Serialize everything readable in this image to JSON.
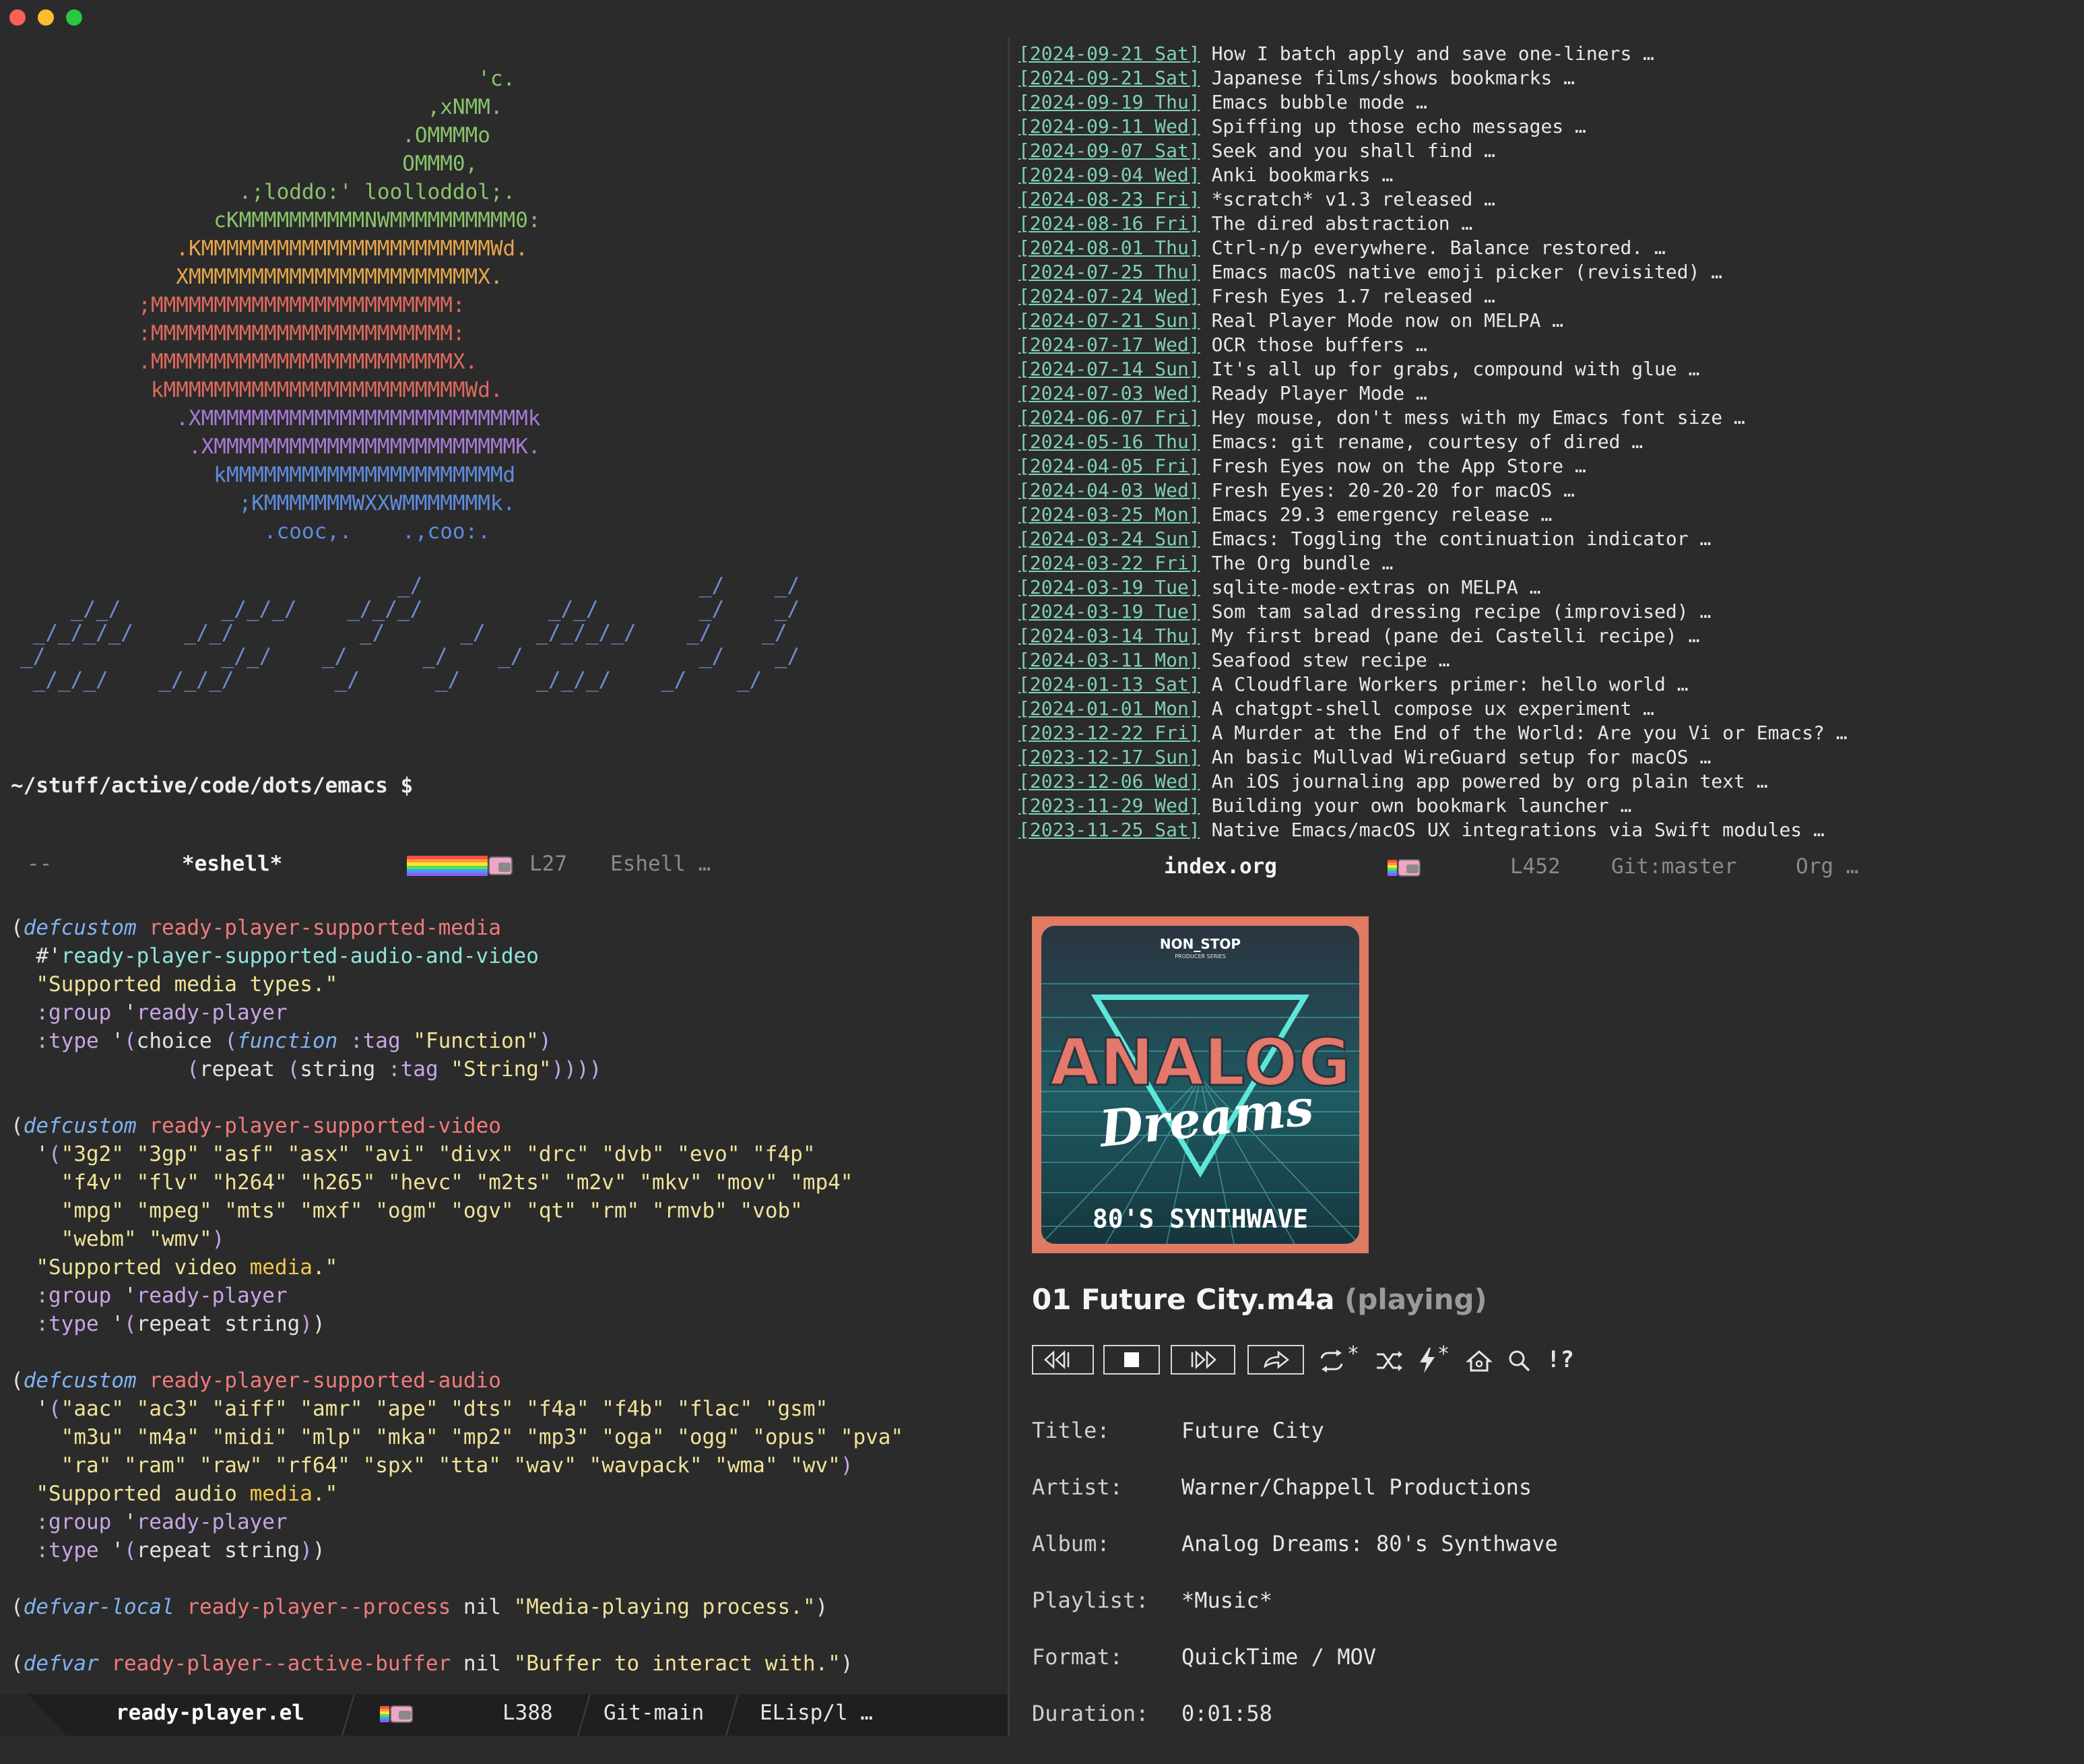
{
  "left_top": {
    "logo_lines": [
      "                                      'c.",
      "                                  ,xNMM.",
      "                                .OMMMMo",
      "                                OMMM0,",
      "                   .;loddo:' loolloddol;.",
      "                 cKMMMMMMMMMMNWMMMMMMMMMM0:",
      "              .KMMMMMMMMMMMMMMMMMMMMMMMWd.",
      "              XMMMMMMMMMMMMMMMMMMMMMMMX.",
      "           ;MMMMMMMMMMMMMMMMMMMMMMMM:",
      "           :MMMMMMMMMMMMMMMMMMMMMMMM:",
      "           .MMMMMMMMMMMMMMMMMMMMMMMMX.",
      "            kMMMMMMMMMMMMMMMMMMMMMMMMWd.",
      "              .XMMMMMMMMMMMMMMMMMMMMMMMMMMk",
      "               .XMMMMMMMMMMMMMMMMMMMMMMMMK.",
      "                 kMMMMMMMMMMMMMMMMMMMMMMd",
      "                   ;KMMMMMMMWXXWMMMMMMMk.",
      "                     .cooc,.    .,coo:."
    ],
    "logo_colors": [
      "#89c46b",
      "#89c46b",
      "#89c46b",
      "#89c46b",
      "#89c46b",
      "#89c46b",
      "#e6a64a",
      "#e6a64a",
      "#e0695d",
      "#e0695d",
      "#e0695d",
      "#e0695d",
      "#a97ad6",
      "#a97ad6",
      "#5f8de0",
      "#5f8de0",
      "#5f8de0"
    ],
    "slant_lines": [
      "                              _/                      _/    _/",
      "    _/_/        _/_/_/    _/_/_/          _/_/        _/    _/",
      " _/_/_/_/    _/_/          _/      _/    _/_/_/_/    _/    _/",
      "_/              _/_/    _/      _/    _/              _/    _/",
      " _/_/_/    _/_/_/        _/      _/      _/_/_/    _/    _/"
    ],
    "prompt": "~/stuff/active/code/dots/emacs $"
  },
  "left_top_modeline": {
    "dashes": "--",
    "buffer": "*eshell*",
    "line": "L27",
    "mode": "Eshell …"
  },
  "org_entries": [
    {
      "date": "[2024-09-21 Sat]",
      "title": "How I batch apply and save one-liners …"
    },
    {
      "date": "[2024-09-21 Sat]",
      "title": "Japanese films/shows bookmarks …"
    },
    {
      "date": "[2024-09-19 Thu]",
      "title": "Emacs bubble mode …"
    },
    {
      "date": "[2024-09-11 Wed]",
      "title": "Spiffing up those echo messages …"
    },
    {
      "date": "[2024-09-07 Sat]",
      "title": "Seek and you shall find …"
    },
    {
      "date": "[2024-09-04 Wed]",
      "title": "Anki bookmarks …"
    },
    {
      "date": "[2024-08-23 Fri]",
      "title": "*scratch* v1.3 released …"
    },
    {
      "date": "[2024-08-16 Fri]",
      "title": "The dired abstraction …"
    },
    {
      "date": "[2024-08-01 Thu]",
      "title": "Ctrl-n/p everywhere. Balance restored. …"
    },
    {
      "date": "[2024-07-25 Thu]",
      "title": "Emacs macOS native emoji picker (revisited) …"
    },
    {
      "date": "[2024-07-24 Wed]",
      "title": "Fresh Eyes 1.7 released …"
    },
    {
      "date": "[2024-07-21 Sun]",
      "title": "Real Player Mode now on MELPA …"
    },
    {
      "date": "[2024-07-17 Wed]",
      "title": "OCR those buffers …"
    },
    {
      "date": "[2024-07-14 Sun]",
      "title": "It's all up for grabs, compound with glue …"
    },
    {
      "date": "[2024-07-03 Wed]",
      "title": "Ready Player Mode …"
    },
    {
      "date": "[2024-06-07 Fri]",
      "title": "Hey mouse, don't mess with my Emacs font size …"
    },
    {
      "date": "[2024-05-16 Thu]",
      "title": "Emacs: git rename, courtesy of dired …"
    },
    {
      "date": "[2024-04-05 Fri]",
      "title": "Fresh Eyes now on the App Store …"
    },
    {
      "date": "[2024-04-03 Wed]",
      "title": "Fresh Eyes: 20-20-20 for macOS …"
    },
    {
      "date": "[2024-03-25 Mon]",
      "title": "Emacs 29.3 emergency release …"
    },
    {
      "date": "[2024-03-24 Sun]",
      "title": "Emacs: Toggling the continuation indicator …"
    },
    {
      "date": "[2024-03-22 Fri]",
      "title": "The Org bundle …"
    },
    {
      "date": "[2024-03-19 Tue]",
      "title": "sqlite-mode-extras on MELPA …"
    },
    {
      "date": "[2024-03-19 Tue]",
      "title": "Som tam salad dressing recipe (improvised) …"
    },
    {
      "date": "[2024-03-14 Thu]",
      "title": "My first bread (pane dei Castelli recipe) …"
    },
    {
      "date": "[2024-03-11 Mon]",
      "title": "Seafood stew recipe …"
    },
    {
      "date": "[2024-01-13 Sat]",
      "title": "A Cloudflare Workers primer: hello world …"
    },
    {
      "date": "[2024-01-01 Mon]",
      "title": "A chatgpt-shell compose ux experiment …"
    },
    {
      "date": "[2023-12-22 Fri]",
      "title": "A Murder at the End of the World: Are you Vi or Emacs? …"
    },
    {
      "date": "[2023-12-17 Sun]",
      "title": "An basic Mullvad WireGuard setup for macOS …"
    },
    {
      "date": "[2023-12-06 Wed]",
      "title": "An iOS journaling app powered by org plain text …"
    },
    {
      "date": "[2023-11-29 Wed]",
      "title": "Building your own bookmark launcher …"
    },
    {
      "date": "[2023-11-25 Sat]",
      "title": "Native Emacs/macOS UX integrations via Swift modules …"
    }
  ],
  "right_top_modeline": {
    "buffer": "index.org",
    "line": "L452",
    "vc": "Git:master",
    "mode": "Org …"
  },
  "code": {
    "b1": {
      "kw": "defcustom",
      "name": "ready-player-supported-media",
      "val": "ready-player-supported-audio-and-video",
      "doc": "\"Supported media types.\"",
      "group": "ready-player",
      "tag1": "\"Function\"",
      "tag2": "\"String\""
    },
    "b2": {
      "kw": "defcustom",
      "name": "ready-player-supported-video",
      "l1": "\"3g2\" \"3gp\" \"asf\" \"asx\" \"avi\" \"divx\" \"drc\" \"dvb\" \"evo\" \"f4p\"",
      "l2": "\"f4v\" \"flv\" \"h264\" \"h265\" \"hevc\" \"m2ts\" \"m2v\" \"mkv\" \"mov\" \"mp4\"",
      "l3": "\"mpg\" \"mpeg\" \"mts\" \"mxf\" \"ogm\" \"ogv\" \"qt\" \"rm\" \"rmvb\" \"vob\"",
      "l4": "\"webm\" \"wmv\"",
      "doc_a": "\"Supported video ",
      "doc_b": "media",
      "doc_c": ".\"",
      "group": "ready-player"
    },
    "b3": {
      "kw": "defcustom",
      "name": "ready-player-supported-audio",
      "l1": "\"aac\" \"ac3\" \"aiff\" \"amr\" \"ape\" \"dts\" \"f4a\" \"f4b\" \"flac\" \"gsm\"",
      "l2": "\"m3u\" \"m4a\" \"midi\" \"mlp\" \"mka\" \"mp2\" \"mp3\" \"oga\" \"ogg\" \"opus\" \"pva\"",
      "l3": "\"ra\" \"ram\" \"raw\" \"rf64\" \"spx\" \"tta\" \"wav\" \"wavpack\" \"wma\" \"wv\"",
      "doc_a": "\"Supported audio ",
      "doc_b": "media",
      "doc_c": ".\"",
      "group": "ready-player"
    },
    "b4": {
      "kw": "defvar-local",
      "name": "ready-player--process",
      "doc": "\"Media-playing process.\""
    },
    "b5": {
      "kw": "defvar",
      "name": "ready-player--active-buffer",
      "doc": "\"Buffer to interact with.\""
    }
  },
  "bottom_modeline": {
    "buffer": "ready-player.el",
    "line": "L388",
    "vc": "Git-main",
    "mode": "ELisp/l …"
  },
  "album_art": {
    "badge": "NON_STOP",
    "badge_sub": "PRODUCER SERIES",
    "title": "ANALOG",
    "script": "Dreams",
    "subtitle": "80'S SYNTHWAVE"
  },
  "player": {
    "track": "01 Future City.m4a",
    "state": "(playing)",
    "meta": [
      {
        "key": "Title:",
        "value": "Future City"
      },
      {
        "key": "Artist:",
        "value": "Warner/Chappell Productions"
      },
      {
        "key": "Album:",
        "value": "Analog Dreams: 80's Synthwave"
      },
      {
        "key": "Playlist:",
        "value": "*Music*"
      },
      {
        "key": "Format:",
        "value": "QuickTime / MOV"
      },
      {
        "key": "Duration:",
        "value": "0:01:58"
      }
    ],
    "repeat_suffix": "*",
    "autoplay_suffix": "*",
    "help_label": "!?"
  },
  "colors": {
    "bg": "#2b2b2b",
    "accent_date": "#7fcfb9",
    "keyword": "#7fb3f0",
    "defname": "#f07c7c",
    "string": "#f0e39a"
  }
}
